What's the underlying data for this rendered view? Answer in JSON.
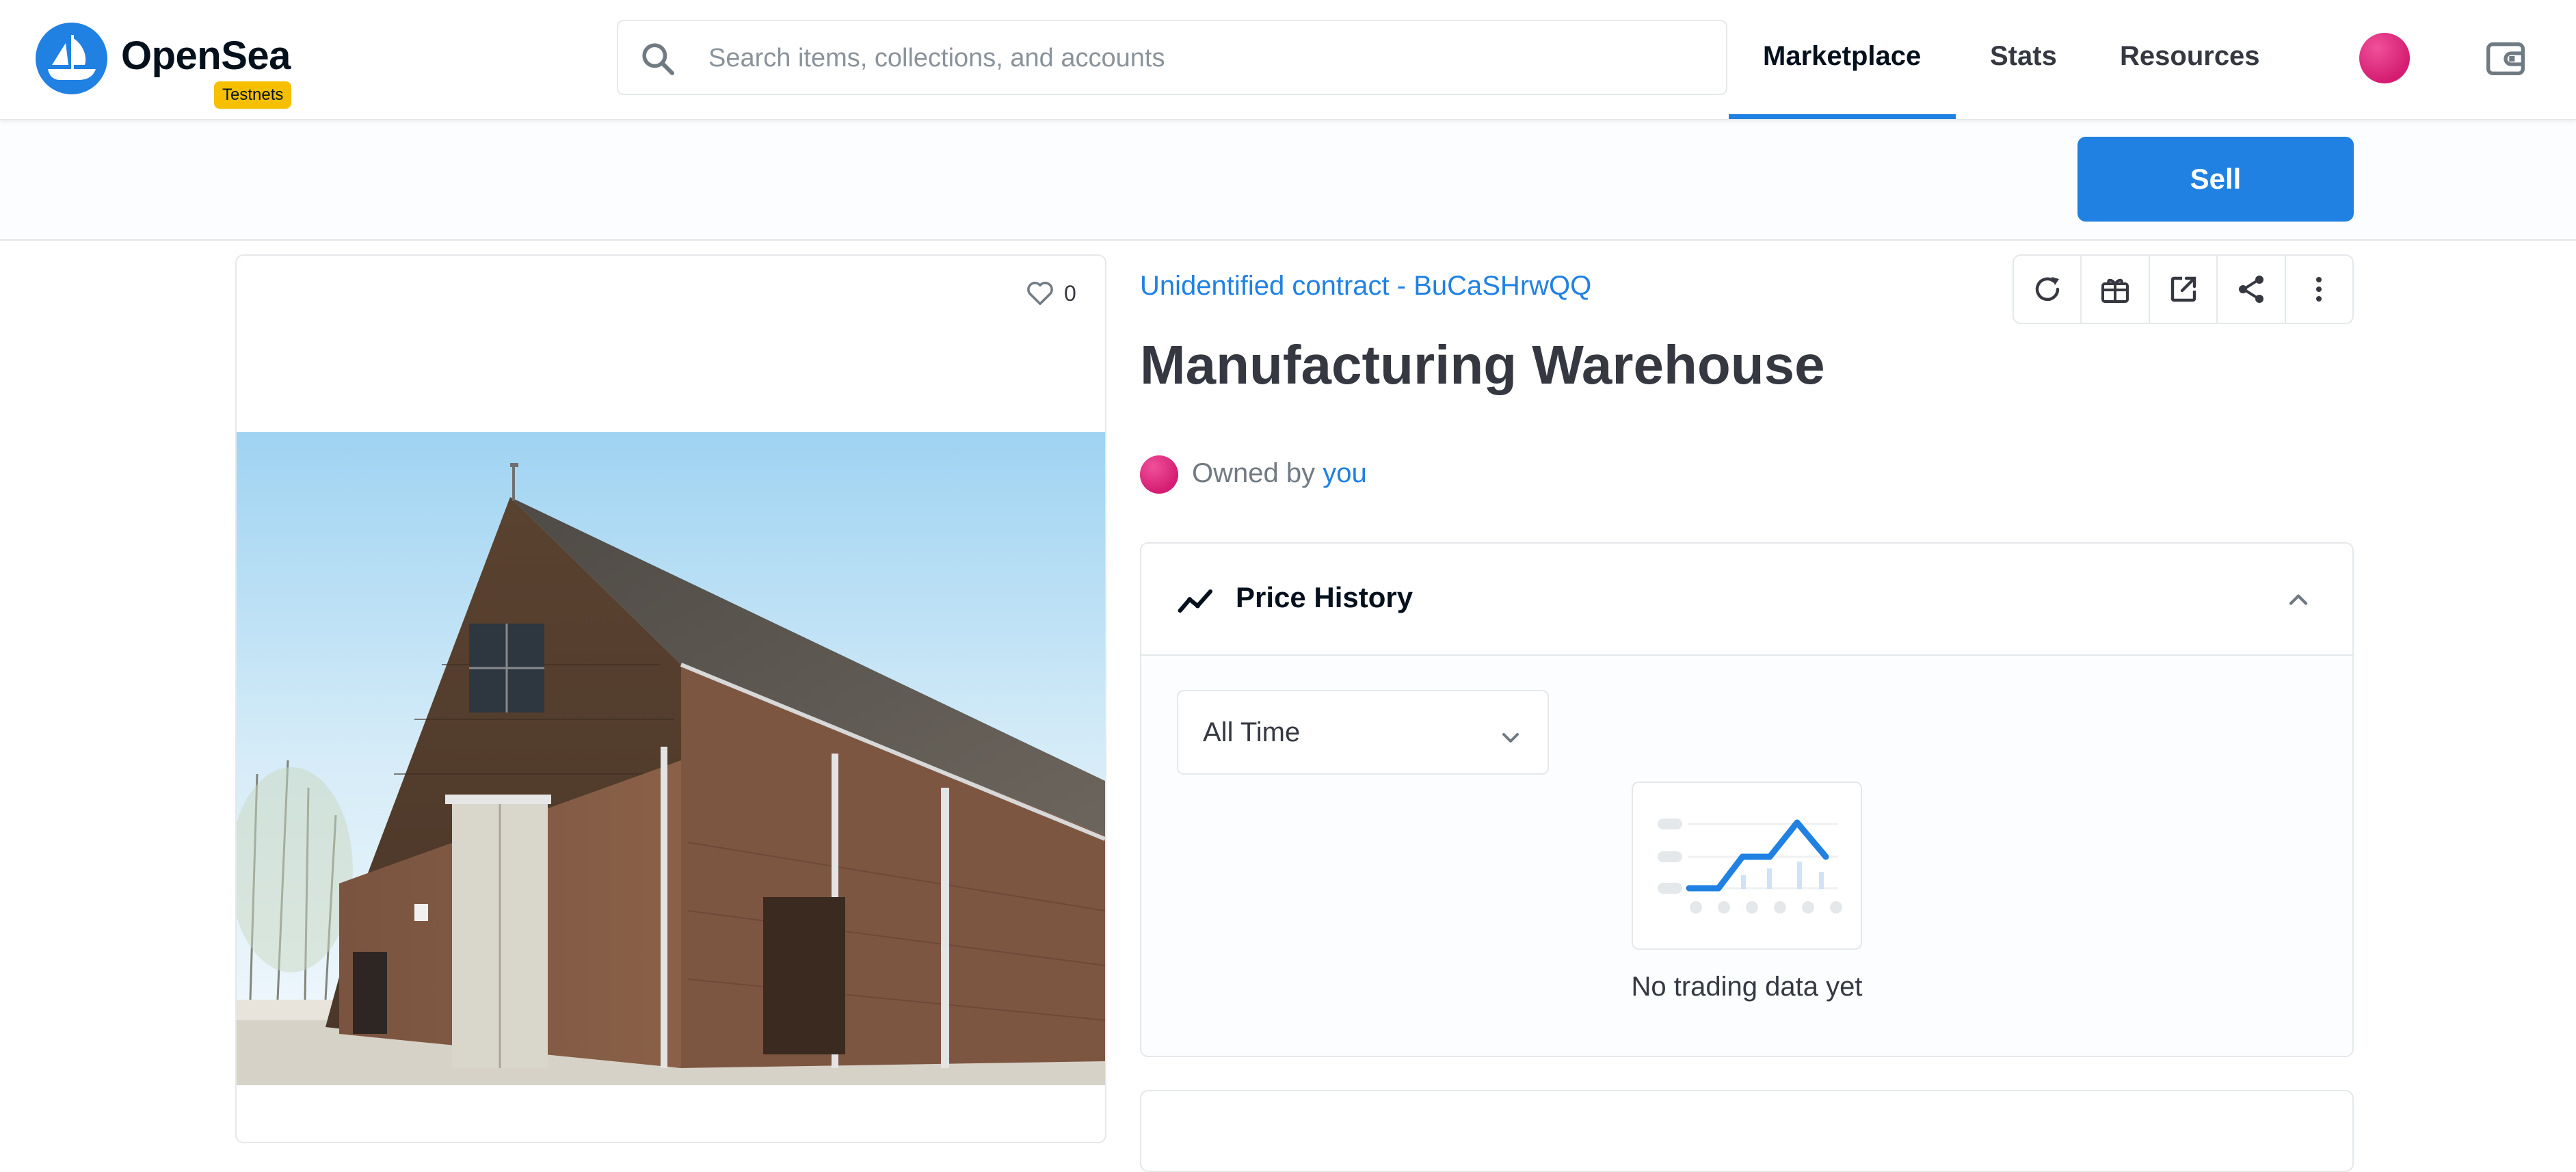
{
  "header": {
    "brand": "OpenSea",
    "badge": "Testnets",
    "search_placeholder": "Search items, collections, and accounts",
    "nav": [
      "Marketplace",
      "Stats",
      "Resources"
    ],
    "active_nav": "Marketplace"
  },
  "toolbar": {
    "sell_label": "Sell"
  },
  "item": {
    "favorites": "0",
    "contract": "Unidentified contract - BuCaSHrwQQ",
    "title": "Manufacturing Warehouse",
    "owned_by_prefix": "Owned by",
    "owner": "you"
  },
  "actions": [
    "refresh-icon",
    "gift-icon",
    "external-link-icon",
    "share-icon",
    "more-vertical-icon"
  ],
  "price_history": {
    "title": "Price History",
    "period": "All Time",
    "empty_text": "No trading data yet"
  },
  "colors": {
    "accent": "#2081e2",
    "badge": "#f6c000",
    "avatar": "#e0287f"
  }
}
